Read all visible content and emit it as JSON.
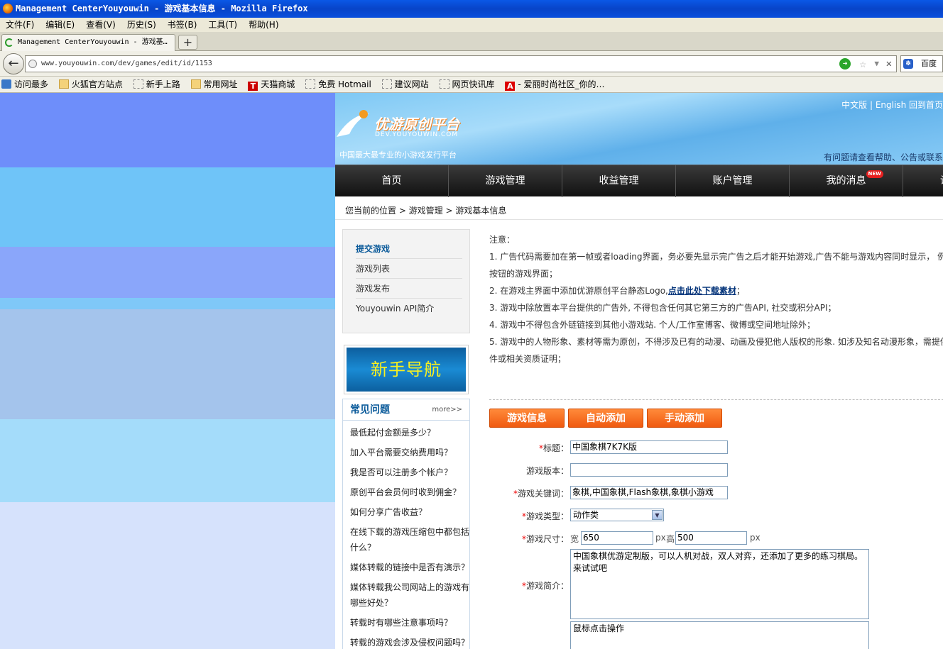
{
  "window": {
    "title": "Management CenterYouyouwin - 游戏基本信息 - Mozilla Firefox"
  },
  "menu": [
    "文件(F)",
    "编辑(E)",
    "查看(V)",
    "历史(S)",
    "书签(B)",
    "工具(T)",
    "帮助(H)"
  ],
  "tab": {
    "label": "Management CenterYouyouwin - 游戏基…",
    "new_tab": "+"
  },
  "nav": {
    "url": "www.youyouwin.com/dev/games/edit/id/1153",
    "search_label": "百度"
  },
  "bookmarks": [
    "访问最多",
    "火狐官方站点",
    "新手上路",
    "常用网址",
    "天猫商城",
    "免费 Hotmail",
    "建议网站",
    "网页快讯库",
    "- 爱丽时尚社区_你的…"
  ],
  "header": {
    "logo_text": "优游原创平台",
    "logo_sub": "DEV.YOUYOUWIN.COM",
    "slogan": "中国最大最专业的小游戏发行平台",
    "lang": "中文版 | English    回到首页",
    "help_line": "有问题请查看帮助、公告或联系"
  },
  "mainnav": {
    "items": [
      "首页",
      "游戏管理",
      "收益管理",
      "账户管理",
      "我的消息",
      "设"
    ],
    "new_badge": "NEW"
  },
  "breadcrumb": "您当前的位置 > 游戏管理 > 游戏基本信息",
  "sidebar": {
    "menu": [
      "提交游戏",
      "游戏列表",
      "游戏发布",
      "Youyouwin API简介"
    ],
    "guide": "新手导航",
    "faq_title": "常见问题",
    "faq_more": "more>>",
    "faq": [
      "最低起付金额是多少？",
      "加入平台需要交纳费用吗？",
      "我是否可以注册多个帐户？",
      "原创平台会员何时收到佣金？",
      "如何分享广告收益？",
      "在线下载的游戏压缩包中都包括",
      "什么？",
      "媒体转载的链接中是否有演示？",
      "媒体转载我公司网站上的游戏有",
      "哪些好处？",
      "转载时有哪些注意事项吗？",
      "转载的游戏会涉及侵权问题吗？"
    ]
  },
  "notice": {
    "title": "注意：",
    "lines": [
      "1. 广告代码需要加在第一帧或者loading界面，务必要先显示完广告之后才能开始游戏,广告不能与游戏内容同时显示， 例如",
      "按钮的游戏界面；",
      "2. 在游戏主界面中添加优游原创平台静态Logo,",
      "3. 游戏中除放置本平台提供的广告外, 不得包含任何其它第三方的广告API, 社交或积分API；",
      "4. 游戏中不得包含外链链接到其他小游戏站. 个人/工作室博客、微博或空间地址除外；",
      "5. 游戏中的人物形象、素材等需为原创，不得涉及已有的动漫、动画及侵犯他人版权的形象. 如涉及知名动漫形象，需提供",
      "件或相关资质证明；"
    ],
    "link": "点击此处下载素材",
    "link_suffix": "；"
  },
  "tabs": [
    "游戏信息",
    "自动添加",
    "手动添加"
  ],
  "form": {
    "title_label": "标题：",
    "title_value": "中国象棋7K7K版",
    "version_label": "游戏版本：",
    "version_value": "",
    "keywords_label": "游戏关键词：",
    "keywords_value": "象棋,中国象棋,Flash象棋,象棋小游戏",
    "type_label": "游戏类型：",
    "type_value": "动作类",
    "size_label": "游戏尺寸：",
    "width_label": "宽",
    "width_value": "650",
    "px1": "px",
    "height_label": "高",
    "height_value": "500",
    "px2": "px",
    "desc_label": "游戏简介：",
    "desc_value": "中国象棋优游定制版，可以人机对战，双人对弈，还添加了更多的练习棋局。来试试吧",
    "ops_value": "鼠标点击操作",
    "required": "*"
  }
}
